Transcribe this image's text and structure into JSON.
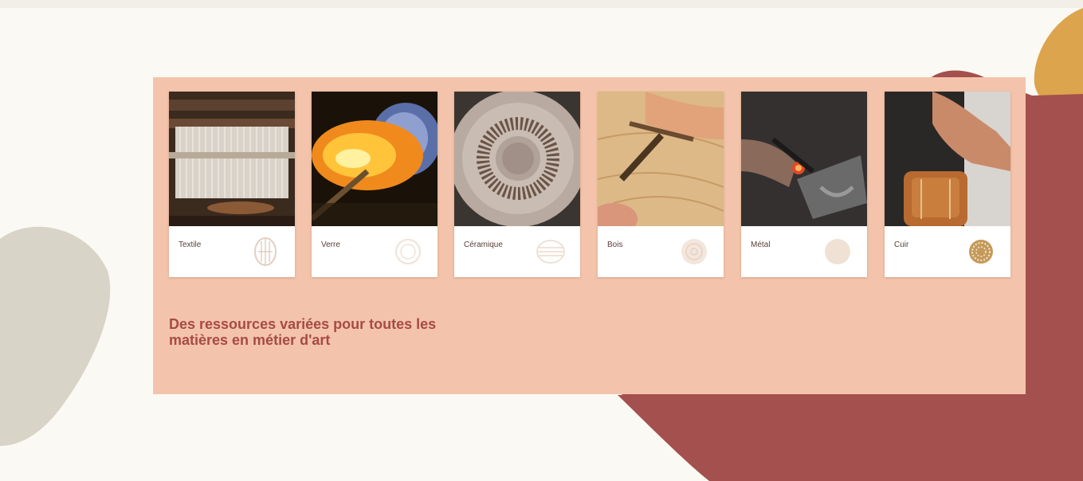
{
  "materials": [
    {
      "label": "Textile",
      "photo_icon": "loom-photo",
      "emblem_icon": "textile-emblem-icon"
    },
    {
      "label": "Verre",
      "photo_icon": "glassblowing-photo",
      "emblem_icon": "glass-emblem-icon"
    },
    {
      "label": "Céramique",
      "photo_icon": "ceramic-photo",
      "emblem_icon": "ceramic-emblem-icon"
    },
    {
      "label": "Bois",
      "photo_icon": "woodcarving-photo",
      "emblem_icon": "wood-emblem-icon"
    },
    {
      "label": "Métal",
      "photo_icon": "metalwork-photo",
      "emblem_icon": "metal-emblem-icon"
    },
    {
      "label": "Cuir",
      "photo_icon": "leatherwork-photo",
      "emblem_icon": "leather-emblem-icon"
    }
  ],
  "tagline": {
    "line1": "Des ressources variées pour toutes les",
    "line2": "matières en métier d'art"
  },
  "colors": {
    "page_background": "#fbf9f3",
    "panel": "#f3c4ab",
    "maroon_shape": "#a4504e",
    "mustard_shape": "#dca44c",
    "grey_shape": "#d9d4c8",
    "tagline_text": "#a84a45"
  }
}
